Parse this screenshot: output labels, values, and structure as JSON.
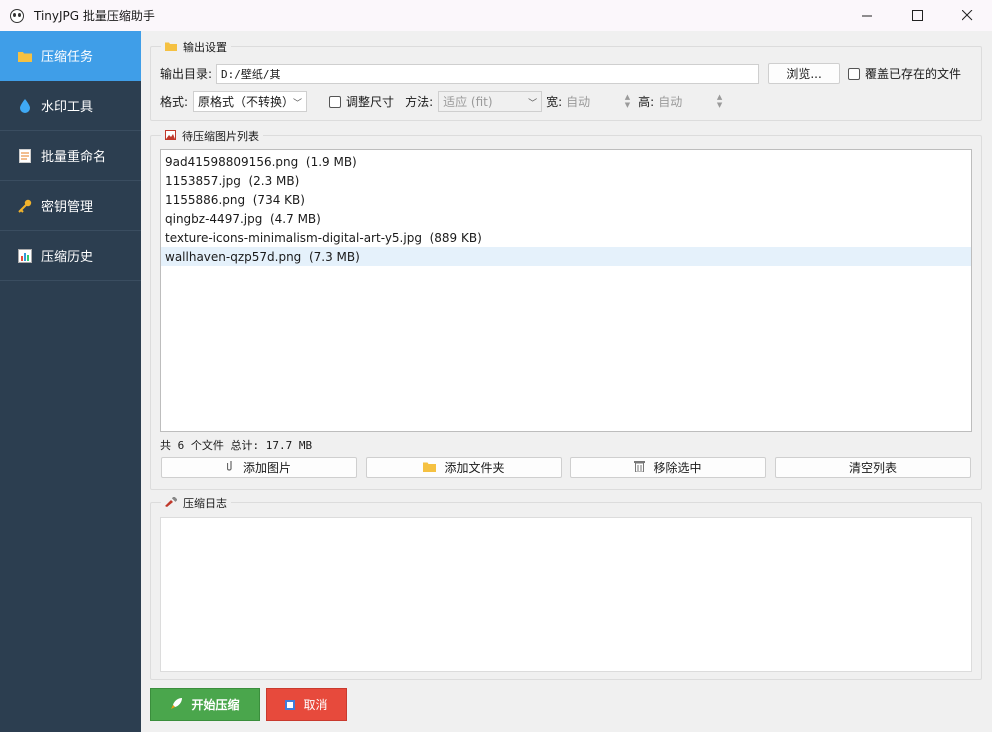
{
  "window": {
    "title": "TinyJPG 批量压缩助手",
    "controls": [
      "—",
      "☐",
      "✕"
    ]
  },
  "sidebar": {
    "items": [
      {
        "label": "压缩任务",
        "icon": "folder-icon",
        "active": true
      },
      {
        "label": "水印工具",
        "icon": "droplet-icon",
        "active": false
      },
      {
        "label": "批量重命名",
        "icon": "document-icon",
        "active": false
      },
      {
        "label": "密钥管理",
        "icon": "key-icon",
        "active": false
      },
      {
        "label": "压缩历史",
        "icon": "chart-icon",
        "active": false
      }
    ]
  },
  "output": {
    "group_title": "输出设置",
    "dir_label": "输出目录:",
    "dir_value": "D:/壁纸/其",
    "browse_label": "浏览...",
    "overwrite_label": "覆盖已存在的文件",
    "overwrite_checked": false,
    "format_label": "格式:",
    "format_value": "原格式（不转换）",
    "resize_label": "调整尺寸",
    "resize_checked": false,
    "method_label": "方法:",
    "method_value": "适应 (fit)",
    "width_label": "宽:",
    "width_value": "自动",
    "height_label": "高:",
    "height_value": "自动"
  },
  "files": {
    "group_title": "待压缩图片列表",
    "items": [
      {
        "name": "9ad41598809156.png",
        "size": "(1.9 MB)"
      },
      {
        "name": "1153857.jpg",
        "size": "(2.3 MB)"
      },
      {
        "name": "1155886.png",
        "size": "(734 KB)"
      },
      {
        "name": "qingbz-4497.jpg",
        "size": "(4.7 MB)"
      },
      {
        "name": "texture-icons-minimalism-digital-art-y5.jpg",
        "size": "(889 KB)"
      },
      {
        "name": "wallhaven-qzp57d.png",
        "size": "(7.3 MB)",
        "selected": true
      }
    ],
    "summary": "共 6 个文件 总计: 17.7 MB",
    "buttons": {
      "add_images": "添加图片",
      "add_folder": "添加文件夹",
      "remove_selected": "移除选中",
      "clear_list": "清空列表"
    }
  },
  "log": {
    "group_title": "压缩日志"
  },
  "actions": {
    "start_label": "开始压缩",
    "cancel_label": "取消"
  },
  "colors": {
    "sidebar_bg": "#2c3e50",
    "sidebar_active": "#3f9ee8",
    "start_button": "#4aa64c",
    "cancel_button": "#e74a3c",
    "selected_row": "#e5f1fb"
  }
}
